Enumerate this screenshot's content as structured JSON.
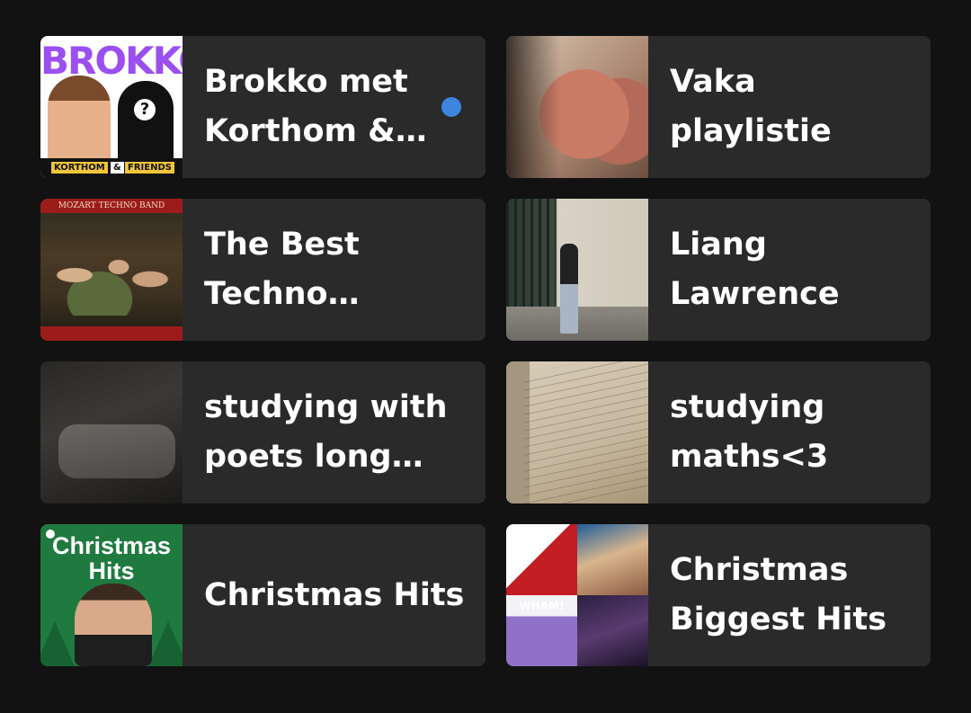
{
  "library": {
    "items": [
      {
        "title": "Brokko met Korthom & Friends",
        "unread_dot": true,
        "artwork": {
          "logo": "BROKKO",
          "question": "?",
          "tag_left": "KORTHOM",
          "tag_mid": "&",
          "tag_right": "FRIENDS"
        }
      },
      {
        "title": "Vaka playlistie",
        "unread_dot": false
      },
      {
        "title": "The Best Techno Remixes of Classical Music",
        "unread_dot": false,
        "artwork": {
          "band_name": "MOZART TECHNO BAND"
        }
      },
      {
        "title": "Liang Lawrence",
        "unread_dot": false
      },
      {
        "title": "studying with poets long gone",
        "unread_dot": false
      },
      {
        "title": "studying maths<3",
        "unread_dot": false
      },
      {
        "title": "Christmas Hits",
        "unread_dot": false,
        "artwork": {
          "cover_text": "Christmas Hits"
        }
      },
      {
        "title": "Christmas Biggest Hits",
        "unread_dot": false,
        "artwork": {
          "mosaic_text": "WHAM!"
        }
      }
    ]
  },
  "colors": {
    "background": "#121212",
    "card": "#2a2a2a",
    "text": "#ffffff",
    "unread_dot": "#3d85de"
  }
}
